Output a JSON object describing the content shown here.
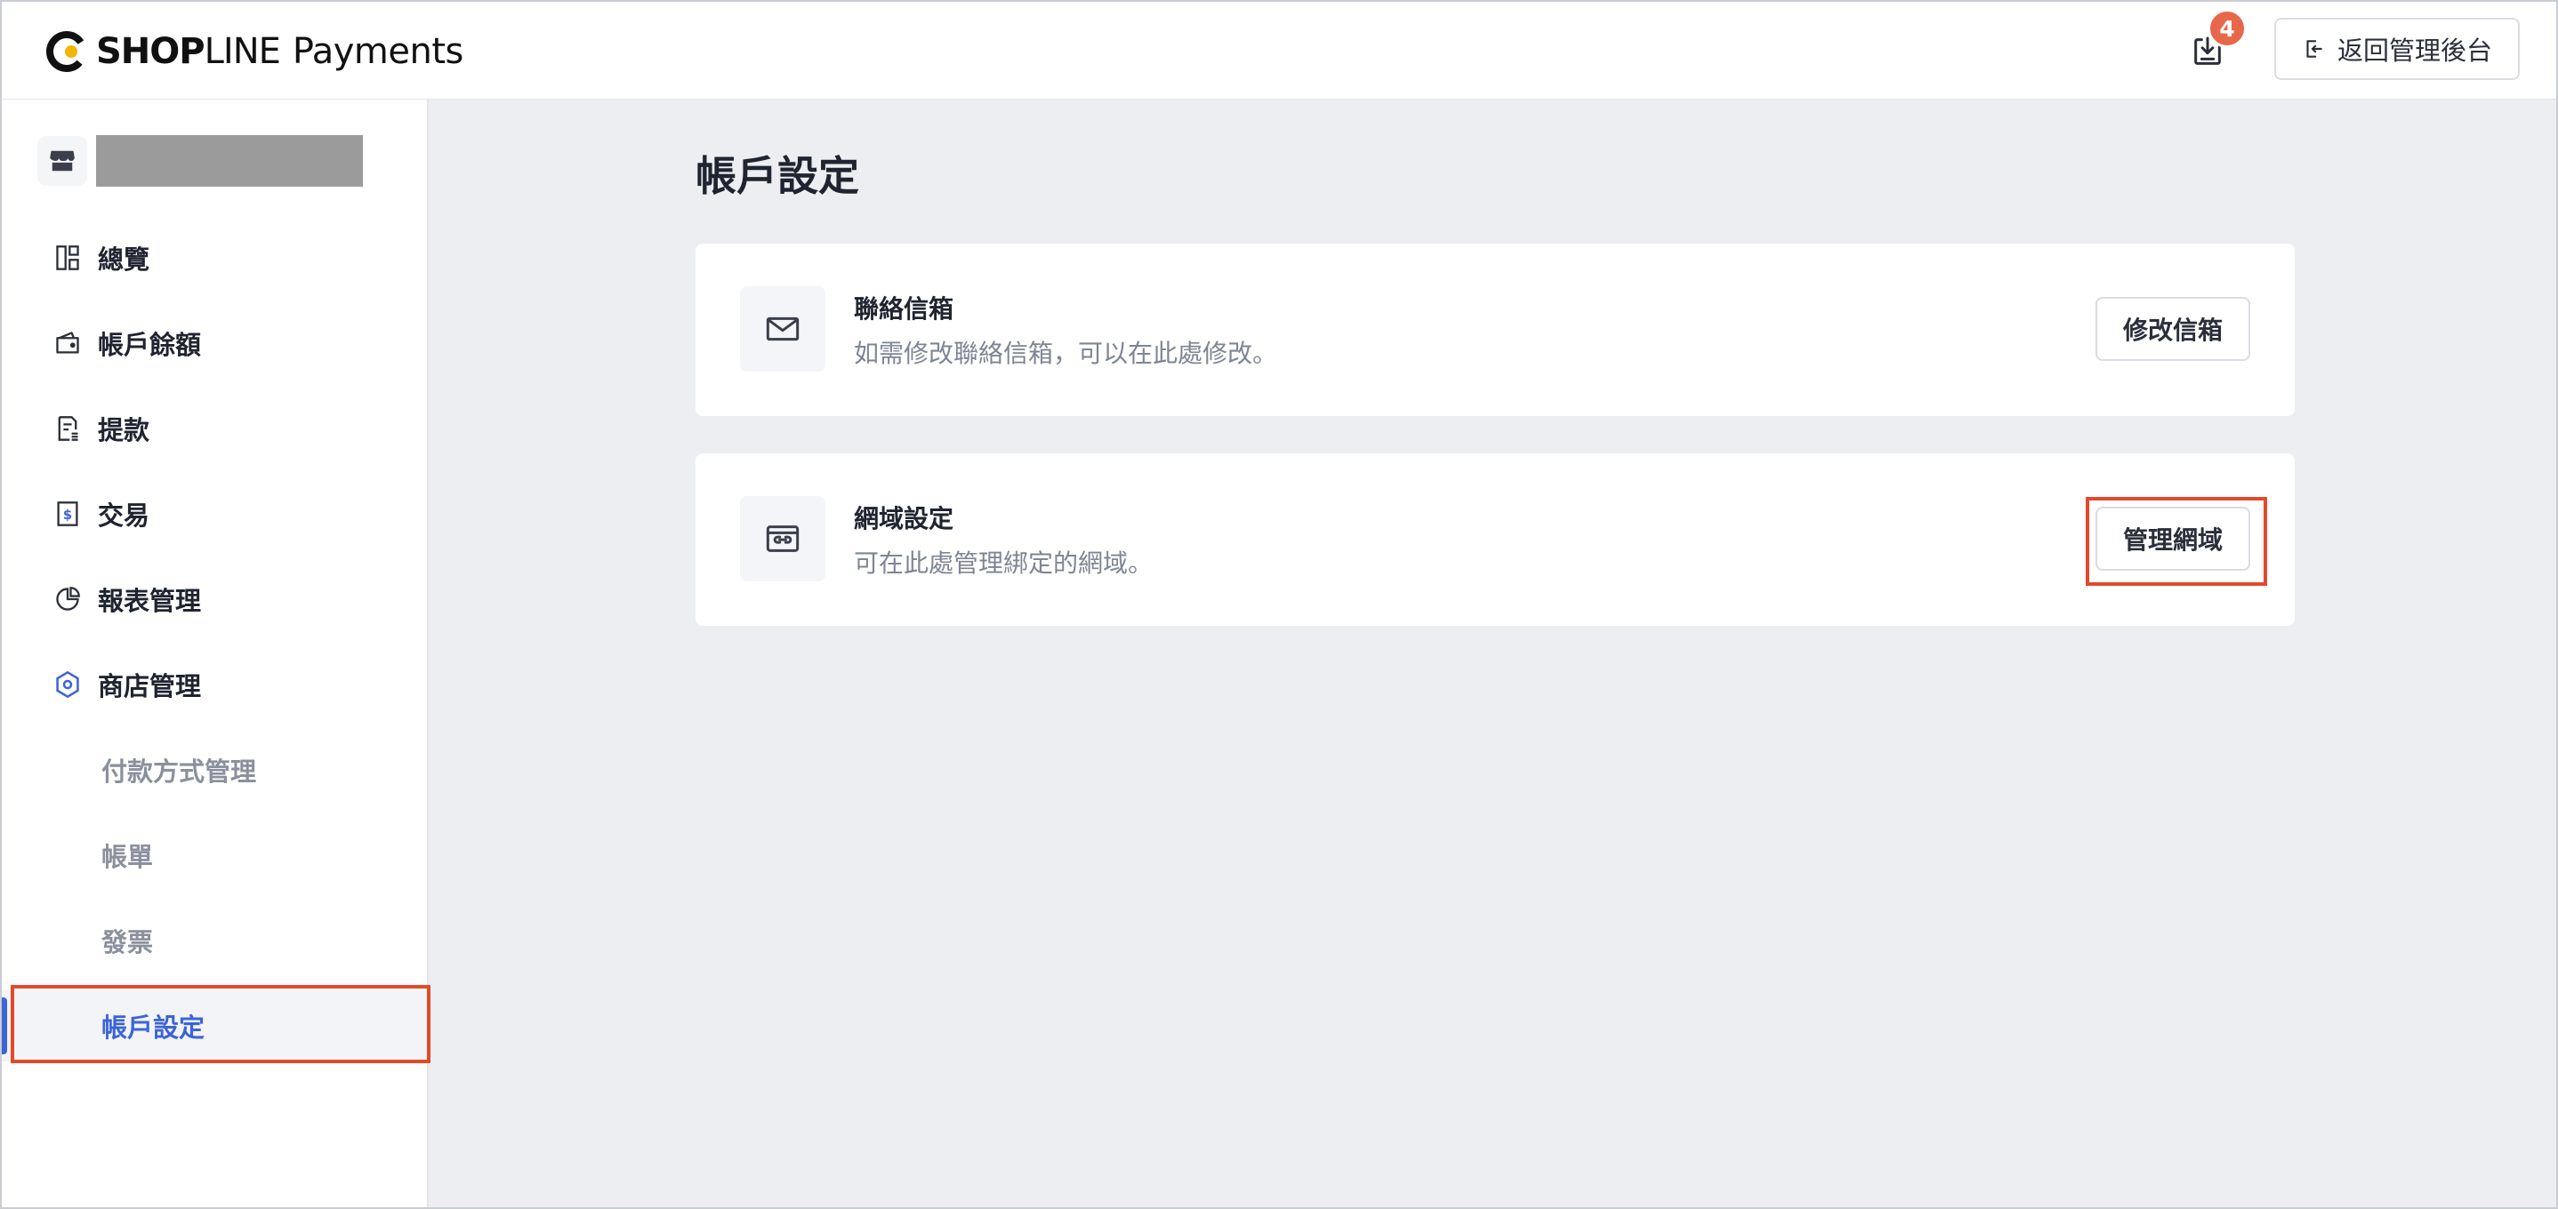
{
  "header": {
    "brand_bold": "SHOP",
    "brand_light": "LINE",
    "product": "Payments",
    "notification_count": "4",
    "back_button_label": "返回管理後台"
  },
  "sidebar": {
    "items": [
      {
        "label": "總覽",
        "icon": "dashboard-icon"
      },
      {
        "label": "帳戶餘額",
        "icon": "wallet-icon"
      },
      {
        "label": "提款",
        "icon": "withdraw-icon"
      },
      {
        "label": "交易",
        "icon": "transaction-icon"
      },
      {
        "label": "報表管理",
        "icon": "report-icon"
      },
      {
        "label": "商店管理",
        "icon": "store-settings-icon"
      }
    ],
    "sub_items": [
      {
        "label": "付款方式管理"
      },
      {
        "label": "帳單"
      },
      {
        "label": "發票"
      },
      {
        "label": "帳戶設定",
        "active": true
      }
    ]
  },
  "main": {
    "title": "帳戶設定",
    "cards": [
      {
        "title": "聯絡信箱",
        "description": "如需修改聯絡信箱，可以在此處修改。",
        "button_label": "修改信箱",
        "icon": "mail-icon"
      },
      {
        "title": "網域設定",
        "description": "可在此處管理綁定的網域。",
        "button_label": "管理網域",
        "icon": "domain-link-icon"
      }
    ]
  },
  "colors": {
    "accent": "#3b64d8",
    "badge": "#e8674a",
    "highlight": "#e24a2b",
    "background": "#eceef2"
  }
}
